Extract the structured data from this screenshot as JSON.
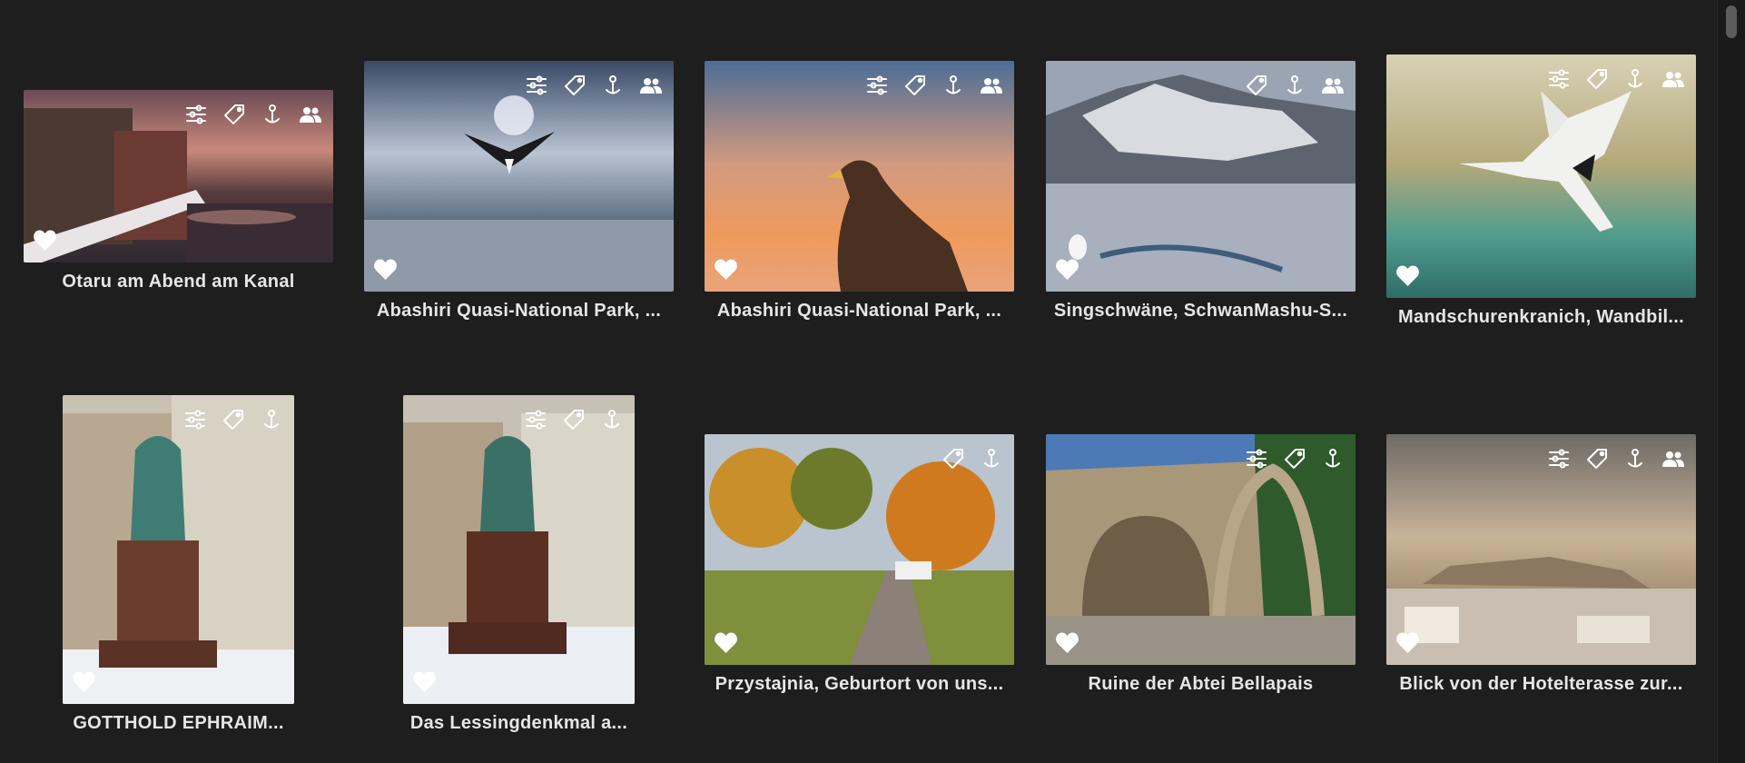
{
  "photos": [
    {
      "caption": "Otaru am Abend am Kanal",
      "icons": [
        "adjustments-icon",
        "tag-icon",
        "location-pin-icon",
        "people-icon"
      ]
    },
    {
      "caption": "Abashiri Quasi-National Park, ...",
      "icons": [
        "adjustments-icon",
        "tag-icon",
        "location-pin-icon",
        "people-icon"
      ]
    },
    {
      "caption": "Abashiri Quasi-National Park, ...",
      "icons": [
        "adjustments-icon",
        "tag-icon",
        "location-pin-icon",
        "people-icon"
      ]
    },
    {
      "caption": "Singschwäne, SchwanMashu-S...",
      "icons": [
        "tag-icon",
        "location-pin-icon",
        "people-icon"
      ]
    },
    {
      "caption": "Mandschurenkranich, Wandbil...",
      "icons": [
        "adjustments-icon",
        "tag-icon",
        "location-pin-icon",
        "people-icon"
      ]
    },
    {
      "caption": "GOTTHOLD EPHRAIM...",
      "icons": [
        "adjustments-icon",
        "tag-icon",
        "location-pin-icon"
      ]
    },
    {
      "caption": "Das Lessingdenkmal a...",
      "icons": [
        "adjustments-icon",
        "tag-icon",
        "location-pin-icon"
      ]
    },
    {
      "caption": "Przystajnia, Geburtort von uns...",
      "icons": [
        "tag-icon",
        "location-pin-icon"
      ]
    },
    {
      "caption": "Ruine der Abtei Bellapais",
      "icons": [
        "adjustments-icon",
        "tag-icon",
        "location-pin-icon"
      ]
    },
    {
      "caption": "Blick von der Hotelterasse zur...",
      "icons": [
        "adjustments-icon",
        "tag-icon",
        "location-pin-icon",
        "people-icon"
      ]
    }
  ],
  "favorite_icon": "heart-icon",
  "colors": {
    "background": "#1e1e1e",
    "caption": "#e6e6e6",
    "icon": "#ffffff"
  }
}
